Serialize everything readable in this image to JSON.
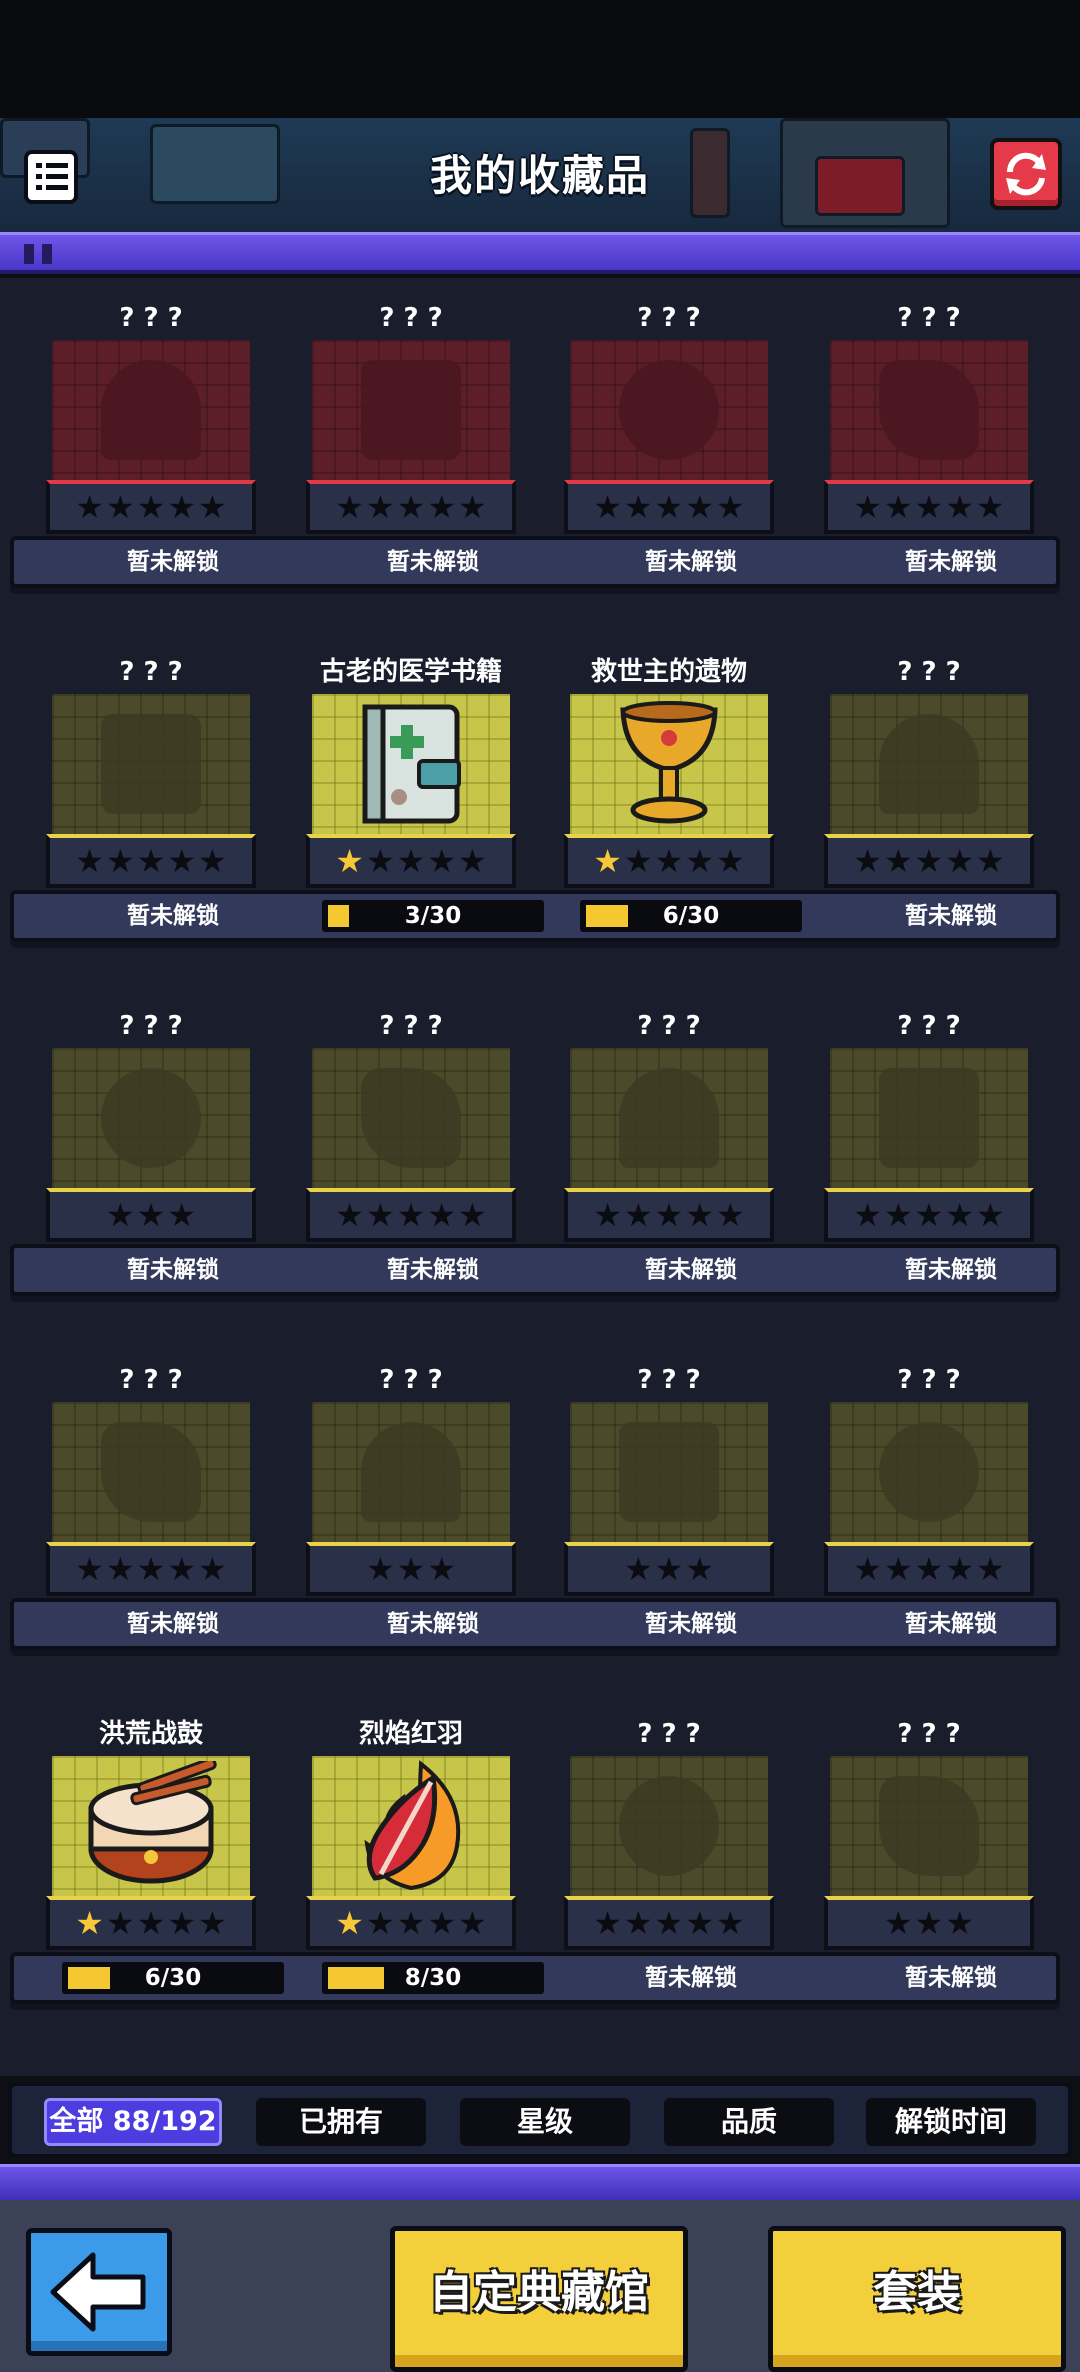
{
  "header": {
    "title": "我的收藏品"
  },
  "colors": {
    "accent_purple": "#5a44dc",
    "star_gold": "#f6c83a",
    "locked_red": "#5c1f2a",
    "tile_yellow": "#c7c64a",
    "button_yellow": "#f4cf3c",
    "back_blue": "#3c9be8"
  },
  "rows": [
    {
      "items": [
        {
          "name": "? ? ?",
          "status": "暂未解锁",
          "stars": 0,
          "style": "red",
          "icon": "locked-silhouette"
        },
        {
          "name": "? ? ?",
          "status": "暂未解锁",
          "stars": 0,
          "style": "red",
          "icon": "locked-silhouette"
        },
        {
          "name": "? ? ?",
          "status": "暂未解锁",
          "stars": 0,
          "style": "red",
          "icon": "locked-silhouette"
        },
        {
          "name": "? ? ?",
          "status": "暂未解锁",
          "stars": 0,
          "style": "red",
          "icon": "locked-silhouette"
        }
      ]
    },
    {
      "items": [
        {
          "name": "? ? ?",
          "status": "暂未解锁",
          "stars": 0,
          "style": "olive",
          "icon": "locked-silhouette"
        },
        {
          "name": "古老的医学书籍",
          "progress": "3/30",
          "progress_value": 3,
          "progress_max": 30,
          "stars": 1,
          "style": "bright",
          "icon": "medical-book-icon"
        },
        {
          "name": "救世主的遗物",
          "progress": "6/30",
          "progress_value": 6,
          "progress_max": 30,
          "stars": 1,
          "style": "bright",
          "icon": "golden-chalice-icon"
        },
        {
          "name": "? ? ?",
          "status": "暂未解锁",
          "stars": 0,
          "style": "olive",
          "icon": "locked-silhouette"
        }
      ]
    },
    {
      "items": [
        {
          "name": "? ? ?",
          "status": "暂未解锁",
          "stars": 0,
          "max_stars": 3,
          "style": "olive",
          "icon": "locked-silhouette"
        },
        {
          "name": "? ? ?",
          "status": "暂未解锁",
          "stars": 0,
          "style": "olive",
          "icon": "locked-silhouette"
        },
        {
          "name": "? ? ?",
          "status": "暂未解锁",
          "stars": 0,
          "style": "olive",
          "icon": "locked-silhouette"
        },
        {
          "name": "? ? ?",
          "status": "暂未解锁",
          "stars": 0,
          "style": "olive",
          "icon": "locked-silhouette"
        }
      ]
    },
    {
      "items": [
        {
          "name": "? ? ?",
          "status": "暂未解锁",
          "stars": 0,
          "style": "olive",
          "icon": "locked-silhouette"
        },
        {
          "name": "? ? ?",
          "status": "暂未解锁",
          "stars": 0,
          "max_stars": 3,
          "style": "olive",
          "icon": "locked-silhouette"
        },
        {
          "name": "? ? ?",
          "status": "暂未解锁",
          "stars": 0,
          "max_stars": 3,
          "style": "olive",
          "icon": "locked-silhouette"
        },
        {
          "name": "? ? ?",
          "status": "暂未解锁",
          "stars": 0,
          "style": "olive",
          "icon": "locked-silhouette"
        }
      ]
    },
    {
      "items": [
        {
          "name": "洪荒战鼓",
          "progress": "6/30",
          "progress_value": 6,
          "progress_max": 30,
          "stars": 1,
          "style": "bright",
          "icon": "war-drum-icon"
        },
        {
          "name": "烈焰红羽",
          "progress": "8/30",
          "progress_value": 8,
          "progress_max": 30,
          "stars": 1,
          "style": "bright",
          "icon": "flame-feather-icon"
        },
        {
          "name": "? ? ?",
          "status": "暂未解锁",
          "stars": 0,
          "style": "olive",
          "icon": "locked-silhouette"
        },
        {
          "name": "? ? ?",
          "status": "暂未解锁",
          "stars": 0,
          "max_stars": 3,
          "style": "olive",
          "icon": "locked-silhouette"
        }
      ]
    }
  ],
  "filters": {
    "all": "全部 88/192",
    "owned": "已拥有",
    "star": "星级",
    "quality": "品质",
    "unlock_time": "解锁时间"
  },
  "bottom": {
    "custom_gallery": "自定典藏馆",
    "outfit": "套装"
  }
}
